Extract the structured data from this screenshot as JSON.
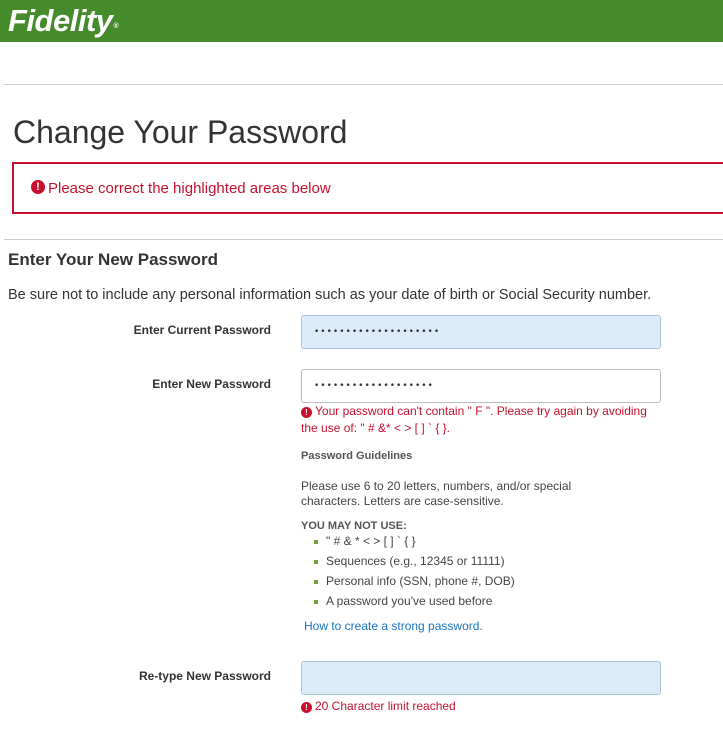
{
  "header": {
    "logo_text": "Fidelity",
    "logo_mark": "®",
    "brand_color": "#458B2B"
  },
  "page": {
    "title": "Change Your Password"
  },
  "alert": {
    "message": "Please correct the highlighted areas below",
    "color": "#C8102E",
    "icon": "alert-circle-icon"
  },
  "section": {
    "title": "Enter Your New Password",
    "description": "Be sure not to include any personal information such as your date of birth or Social Security number."
  },
  "form": {
    "current_password": {
      "label": "Enter Current Password",
      "value": "••••••••••••••••••••"
    },
    "new_password": {
      "label": "Enter New Password",
      "value": "•••••••••••••••••••",
      "error_line1": "Your password can't contain \" F \". Please try again by avoiding",
      "error_line2": "the use of: \" # &* < > [ ] ` { }."
    },
    "retype_password": {
      "label": "Re-type New Password",
      "value": "",
      "error": "20 Character limit reached"
    }
  },
  "guidelines": {
    "title": "Password Guidelines",
    "text": "Please use 6 to 20 letters, numbers, and/or special characters. Letters are case-sensitive.",
    "not_use_title": "YOU MAY NOT USE:",
    "items": [
      "\" # & * < > [ ] ` { }",
      "Sequences (e.g., 12345 or 11111)",
      "Personal info (SSN, phone #, DOB)",
      "A password you've used before"
    ],
    "link": "How to create a strong password."
  }
}
